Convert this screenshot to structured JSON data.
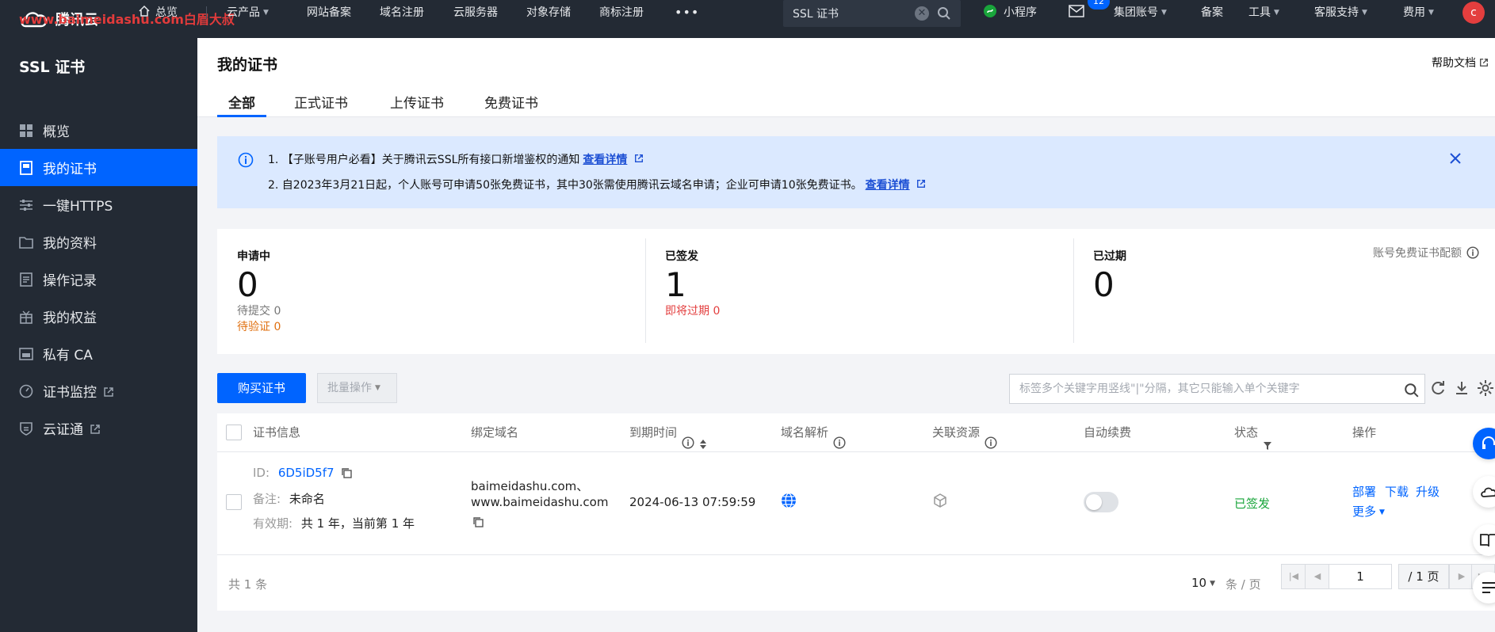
{
  "topbar": {
    "logo_text": "腾讯云",
    "watermark": "www.baimeidashu.com白眉大叔",
    "nav": [
      {
        "label": "总览",
        "has_icon": true
      },
      {
        "label": "云产品",
        "has_caret": true
      },
      {
        "label": "网站备案"
      },
      {
        "label": "域名注册"
      },
      {
        "label": "云服务器"
      },
      {
        "label": "对象存储"
      },
      {
        "label": "商标注册"
      },
      {
        "label": "•••"
      }
    ],
    "search_value": "SSL 证书",
    "right": {
      "miniprogram": "小程序",
      "message_badge": "12",
      "group_account": "集团账号",
      "beian": "备案",
      "tools": "工具",
      "support": "客服支持",
      "fees": "费用",
      "avatar_letter": "c"
    }
  },
  "sidebar": {
    "title": "SSL 证书",
    "items": [
      {
        "label": "概览",
        "icon": "grid-icon",
        "external": false,
        "active": false
      },
      {
        "label": "我的证书",
        "icon": "certificate-icon",
        "external": false,
        "active": true
      },
      {
        "label": "一键HTTPS",
        "icon": "sliders-icon",
        "external": false,
        "active": false
      },
      {
        "label": "我的资料",
        "icon": "folder-icon",
        "external": false,
        "active": false
      },
      {
        "label": "操作记录",
        "icon": "document-icon",
        "external": false,
        "active": false
      },
      {
        "label": "我的权益",
        "icon": "gift-icon",
        "external": false,
        "active": false
      },
      {
        "label": "私有 CA",
        "icon": "ca-icon",
        "external": false,
        "active": false
      },
      {
        "label": "证书监控",
        "icon": "monitor-icon",
        "external": true,
        "active": false
      },
      {
        "label": "云证通",
        "icon": "shield-icon",
        "external": true,
        "active": false
      }
    ]
  },
  "main": {
    "title": "我的证书",
    "help": "帮助文档",
    "tabs": [
      "全部",
      "正式证书",
      "上传证书",
      "免费证书"
    ],
    "active_tab": "全部"
  },
  "notice": {
    "line1_text": "1. 【子账号用户必看】关于腾讯云SSL所有接口新增鉴权的通知",
    "line1_link": "查看详情",
    "line2_text": "2. 自2023年3月21日起，个人账号可申请50张免费证书，其中30张需使用腾讯云域名申请；企业可申请10张免费证书。",
    "line2_link": "查看详情"
  },
  "stats": {
    "applying": {
      "label": "申请中",
      "value": "0",
      "sub1": "待提交 0",
      "sub2": "待验证 0"
    },
    "issued": {
      "label": "已签发",
      "value": "1",
      "sub1": "即将过期 0"
    },
    "expired": {
      "label": "已过期",
      "value": "0"
    },
    "quota_label": "账号免费证书配额"
  },
  "toolbar": {
    "buy_label": "购买证书",
    "batch_label": "批量操作",
    "search_placeholder": "标签多个关键字用竖线\"|\"分隔，其它只能输入单个关键字"
  },
  "table": {
    "headers": {
      "info": "证书信息",
      "domain": "绑定域名",
      "expire": "到期时间",
      "dns": "域名解析",
      "resource": "关联资源",
      "renew": "自动续费",
      "status": "状态",
      "ops": "操作"
    },
    "rows": [
      {
        "id_label": "ID:",
        "id": "6D5iD5f7",
        "note_label": "备注:",
        "note": "未命名",
        "validity_label": "有效期:",
        "validity": "共 1 年，当前第 1 年",
        "domain_line1": "baimeidashu.com、",
        "domain_line2": "www.baimeidashu.com",
        "expire": "2024-06-13 07:59:59",
        "auto_renew": false,
        "status": "已签发",
        "actions": [
          "部署",
          "下载",
          "升级"
        ],
        "more": "更多"
      }
    ],
    "total": "共 1 条",
    "page_size": "10",
    "page_unit": "条 / 页",
    "current_page": "1",
    "total_pages": "/ 1 页"
  },
  "colors": {
    "topbar": "#232a34",
    "accent": "#0064ff",
    "notice_bg": "#dbe9ff",
    "success": "#19a53b",
    "warning": "#e07010",
    "danger": "#e33e3e"
  }
}
